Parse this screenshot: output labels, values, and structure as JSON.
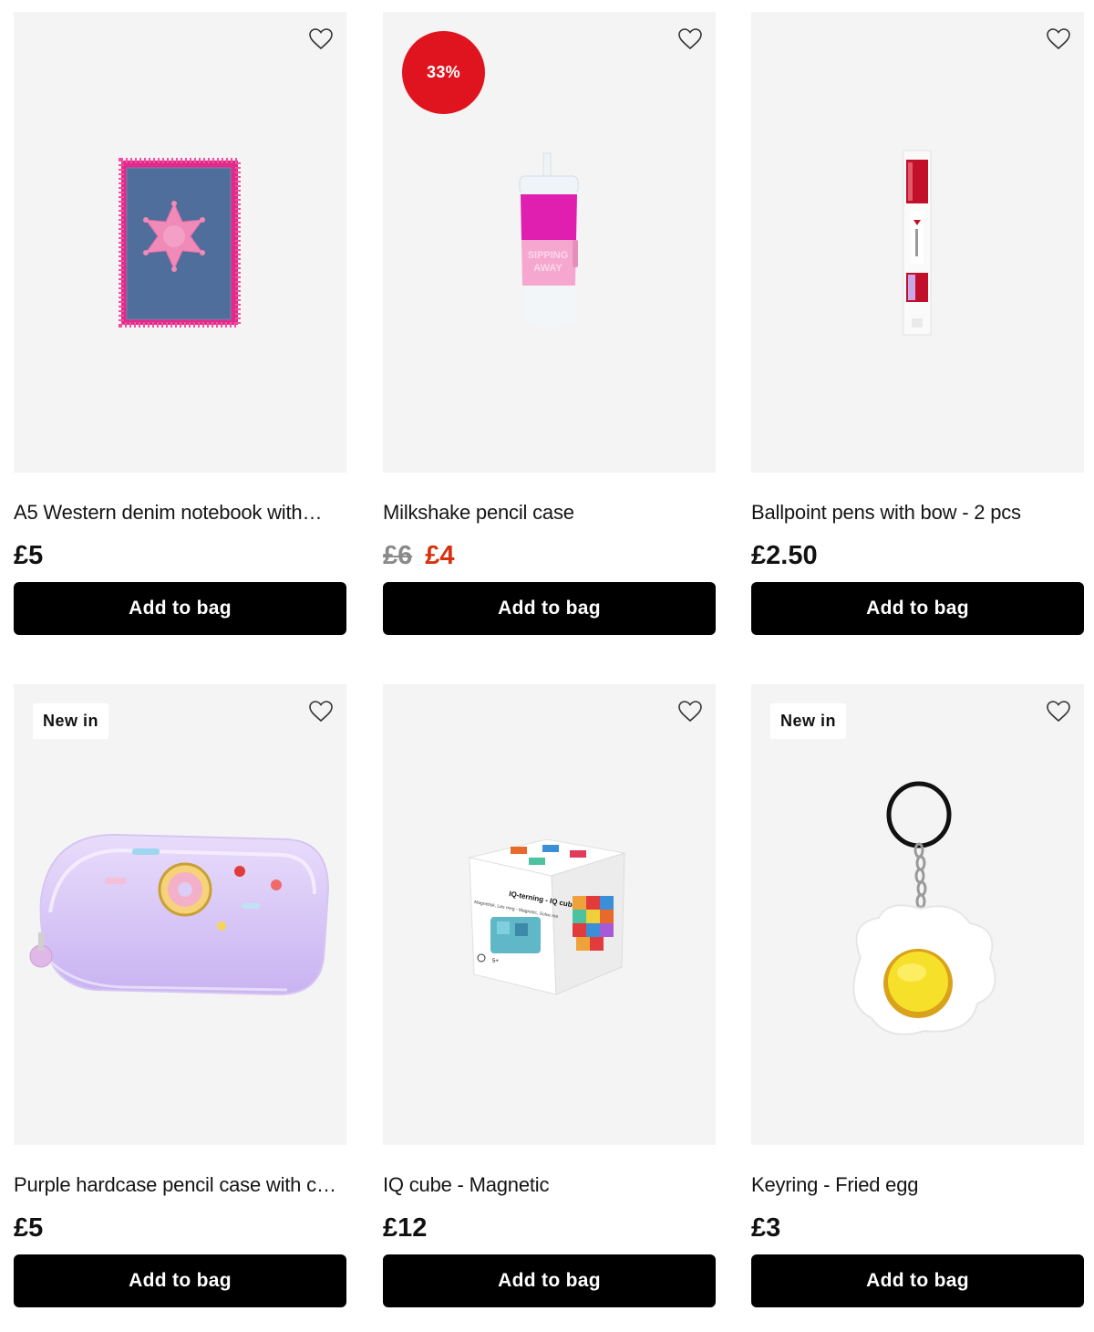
{
  "products": [
    {
      "name": "A5 Western denim notebook with…",
      "price": "£5",
      "add_label": "Add to bag",
      "image": "denim-notebook-image"
    },
    {
      "name": "Milkshake pencil case",
      "old_price": "£6",
      "sale_price": "£4",
      "discount": "33%",
      "add_label": "Add to bag",
      "image": "milkshake-pencil-case-image",
      "cup_text_1": "SIPPING",
      "cup_text_2": "AWAY"
    },
    {
      "name": "Ballpoint pens with bow - 2 pcs",
      "price": "£2.50",
      "add_label": "Add to bag",
      "image": "ballpoint-pens-image"
    },
    {
      "name": "Purple hardcase pencil case with can…",
      "price": "£5",
      "badge": "New in",
      "add_label": "Add to bag",
      "image": "purple-pencil-case-image"
    },
    {
      "name": "IQ cube - Magnetic",
      "price": "£12",
      "add_label": "Add to bag",
      "image": "iq-cube-image",
      "box_title": "IQ-terning - IQ cube",
      "box_sub": "Magnetisk, Løs meg - Magnetic, Solve me",
      "box_age": "5+"
    },
    {
      "name": "Keyring - Fried egg",
      "price": "£3",
      "badge": "New in",
      "add_label": "Add to bag",
      "image": "fried-egg-keyring-image"
    }
  ],
  "colors": {
    "discount_badge": "#e0141e",
    "sale_price": "#d8310f",
    "old_price": "#8a8a8a",
    "button_bg": "#000000",
    "card_bg": "#f4f4f4"
  },
  "icons": {
    "wishlist": "heart-outline-icon"
  }
}
